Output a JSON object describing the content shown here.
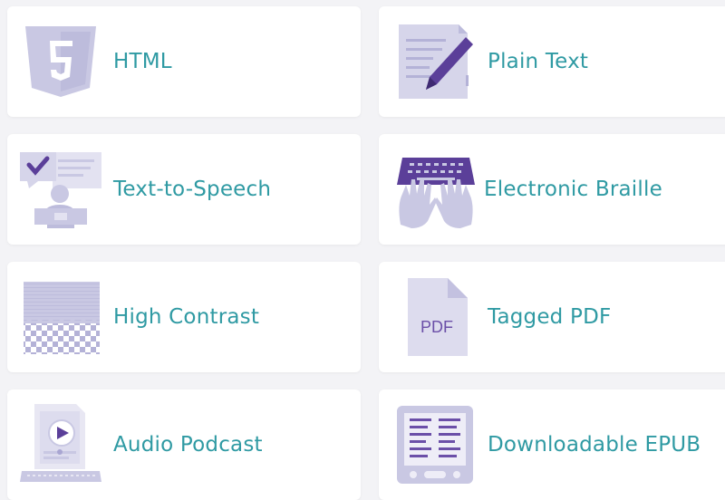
{
  "colors": {
    "background": "#f3f3f6",
    "card": "#ffffff",
    "label": "#2f9aa3",
    "icon_light": "#c9c8e3",
    "icon_mid": "#a9a6d2",
    "icon_accent": "#5b3f99"
  },
  "formats": [
    {
      "label": "HTML",
      "icon": "html5-icon"
    },
    {
      "label": "Plain Text",
      "icon": "document-pen-icon"
    },
    {
      "label": "Text-to-Speech",
      "icon": "text-to-speech-icon"
    },
    {
      "label": "Electronic Braille",
      "icon": "braille-keyboard-icon"
    },
    {
      "label": "High Contrast",
      "icon": "high-contrast-icon"
    },
    {
      "label": "Tagged PDF",
      "icon": "pdf-file-icon",
      "icon_text": "PDF"
    },
    {
      "label": "Audio Podcast",
      "icon": "audio-podcast-icon"
    },
    {
      "label": "Downloadable EPUB",
      "icon": "epub-reader-icon"
    }
  ]
}
